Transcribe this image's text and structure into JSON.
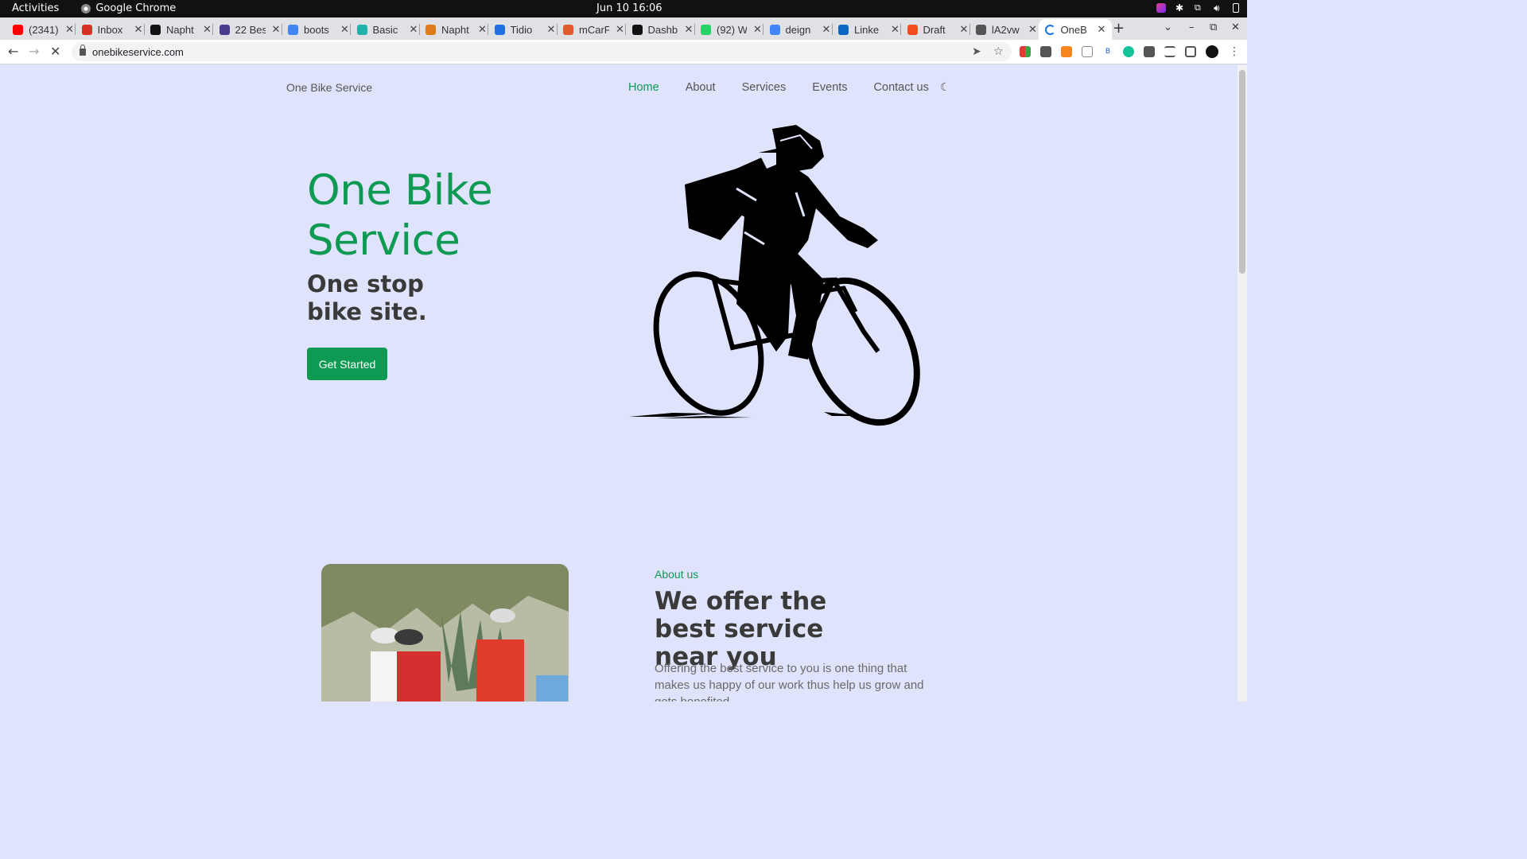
{
  "system": {
    "activities": "Activities",
    "app_name": "Google Chrome",
    "clock": "Jun 10  16:06"
  },
  "tabs": [
    {
      "label": "(2341)",
      "favicon": "youtube-icon",
      "color": "#ff0000"
    },
    {
      "label": "Inbox",
      "favicon": "gmail-icon",
      "color": "#d93025"
    },
    {
      "label": "Napht",
      "favicon": "github-icon",
      "color": "#111111"
    },
    {
      "label": "22 Bes",
      "favicon": "site-icon",
      "color": "#4b3b8f"
    },
    {
      "label": "boots",
      "favicon": "google-icon",
      "color": "#4285f4"
    },
    {
      "label": "Basic",
      "favicon": "leaf-icon",
      "color": "#20b2aa"
    },
    {
      "label": "Napht",
      "favicon": "droplet-icon",
      "color": "#e07b1a"
    },
    {
      "label": "Tidio",
      "favicon": "chat-icon",
      "color": "#1f6fe5"
    },
    {
      "label": "mCarF",
      "favicon": "triangle-icon",
      "color": "#e05a2a"
    },
    {
      "label": "Dashb",
      "favicon": "check-circle-icon",
      "color": "#111111"
    },
    {
      "label": "(92) W",
      "favicon": "whatsapp-icon",
      "color": "#25d366"
    },
    {
      "label": "deign",
      "favicon": "google-icon",
      "color": "#4285f4"
    },
    {
      "label": "Linke",
      "favicon": "linkedin-icon",
      "color": "#0a66c2"
    },
    {
      "label": "Draft",
      "favicon": "figma-icon",
      "color": "#f24e1e"
    },
    {
      "label": "lA2vw",
      "favicon": "globe-icon",
      "color": "#555555"
    },
    {
      "label": "OneB",
      "favicon": "loading-icon",
      "color": "#1a73e8",
      "active": true
    }
  ],
  "omnibox": {
    "url": "onebikeservice.com"
  },
  "site": {
    "brand": "One Bike Service",
    "nav": [
      {
        "label": "Home",
        "active": true
      },
      {
        "label": "About",
        "active": false
      },
      {
        "label": "Services",
        "active": false
      },
      {
        "label": "Events",
        "active": false
      },
      {
        "label": "Contact us",
        "active": false
      }
    ],
    "theme_icon": "moon-icon",
    "hero": {
      "title": "One Bike Service",
      "subtitle": "One stop bike site.",
      "cta": "Get Started"
    },
    "about": {
      "kicker": "About us",
      "title": "We offer the best service near you",
      "body": "Offering the best service to you is one thing that makes us happy of our work thus help us grow and gets benefited"
    }
  },
  "colors": {
    "accent": "#0e9a53",
    "page_bg": "#e0e3fc",
    "heading": "#3a3a3a"
  }
}
